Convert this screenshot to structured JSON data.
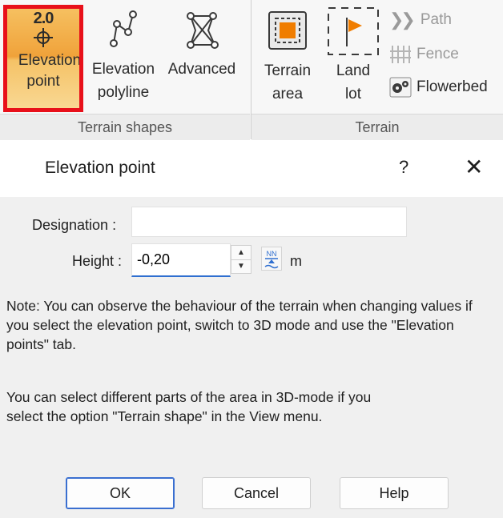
{
  "ribbon": {
    "groups": {
      "terrain_shapes": "Terrain shapes",
      "terrain": "Terrain"
    },
    "buttons": {
      "elevation_point": {
        "icon_text": "2.0",
        "label_line1": "Elevation",
        "label_line2": "point"
      },
      "elevation_polyline": {
        "label_line1": "Elevation",
        "label_line2": "polyline"
      },
      "advanced": {
        "label": "Advanced"
      },
      "terrain_area": {
        "label_line1": "Terrain",
        "label_line2": "area"
      },
      "land_lot": {
        "label_line1": "Land",
        "label_line2": "lot"
      },
      "path": {
        "label": "Path"
      },
      "fence": {
        "label": "Fence"
      },
      "flowerbed": {
        "label": "Flowerbed"
      }
    }
  },
  "dialog": {
    "title": "Elevation point",
    "help": "?",
    "close": "✕",
    "designation": {
      "label": "Designation :",
      "value": ""
    },
    "height": {
      "label": "Height :",
      "value": "-0,20",
      "unit": "m",
      "nn_icon_text": "NN"
    },
    "note1": "Note: You can observe the behaviour of the terrain when changing values if you select the elevation point, switch to 3D mode and use the \"Elevation points\" tab.",
    "note2": "You can select different parts of the area in 3D-mode if you select the option \"Terrain shape\" in the View menu.",
    "buttons": {
      "ok": "OK",
      "cancel": "Cancel",
      "help": "Help"
    }
  },
  "colors": {
    "selected_border": "#e8101a",
    "selected_fill": "#f0a23a",
    "accent_orange": "#f07d00",
    "focus_blue": "#2f6fd0"
  }
}
